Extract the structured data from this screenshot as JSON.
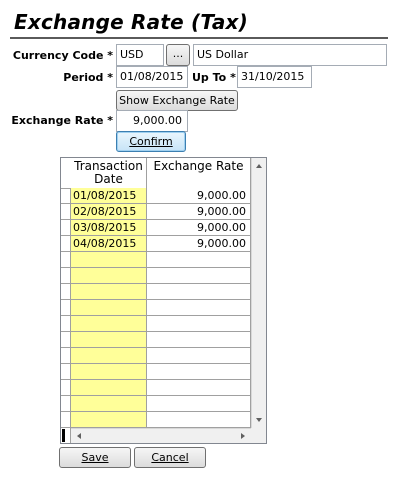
{
  "title": "Exchange Rate (Tax)",
  "form": {
    "currency_code_label": "Currency Code *",
    "currency_code_value": "USD",
    "lookup_button": "...",
    "currency_name": "US Dollar",
    "period_label": "Period *",
    "period_from": "01/08/2015",
    "up_to_label": "Up To *",
    "period_to": "31/10/2015",
    "show_button": "Show Exchange Rate",
    "rate_label": "Exchange Rate *",
    "rate_value": "9,000.00",
    "confirm_button": "Confirm"
  },
  "grid": {
    "columns": [
      "Transaction Date",
      "Exchange Rate"
    ],
    "rows": [
      [
        "01/08/2015",
        "9,000.00"
      ],
      [
        "02/08/2015",
        "9,000.00"
      ],
      [
        "03/08/2015",
        "9,000.00"
      ],
      [
        "04/08/2015",
        "9,000.00"
      ],
      [
        "",
        ""
      ],
      [
        "",
        ""
      ],
      [
        "",
        ""
      ],
      [
        "",
        ""
      ],
      [
        "",
        ""
      ],
      [
        "",
        ""
      ],
      [
        "",
        ""
      ],
      [
        "",
        ""
      ],
      [
        "",
        ""
      ],
      [
        "",
        ""
      ],
      [
        "",
        ""
      ]
    ]
  },
  "footer": {
    "save_button": "Save",
    "cancel_button": "Cancel"
  },
  "colors": {
    "date_column_bg": "#ffff99",
    "title_rule": "#5a5a5a"
  }
}
